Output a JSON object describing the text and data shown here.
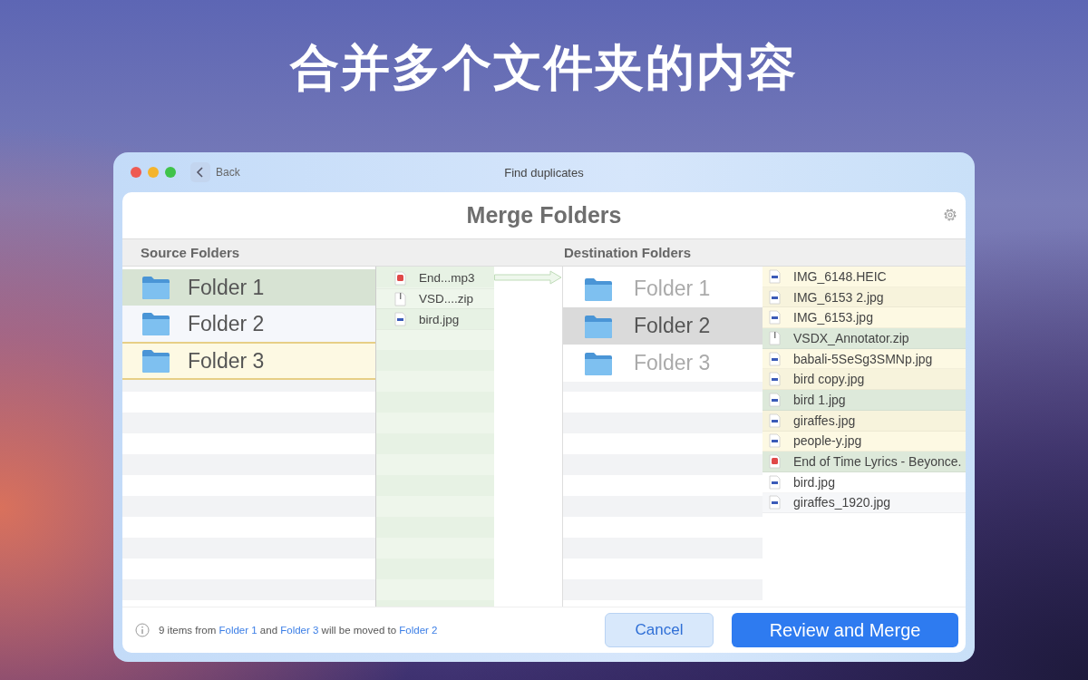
{
  "headline": "合并多个文件夹的内容",
  "window": {
    "title": "Find duplicates",
    "back": "Back"
  },
  "panel": {
    "title": "Merge Folders"
  },
  "source": {
    "heading": "Source Folders",
    "folders": [
      {
        "name": "Folder 1",
        "color": "#d7e3d3"
      },
      {
        "name": "Folder 2",
        "color": "#f5f7fb"
      },
      {
        "name": "Folder 3",
        "color": "#fdf9e3"
      }
    ],
    "files": [
      {
        "name": "End...mp3",
        "kind": "audio"
      },
      {
        "name": "VSD....zip",
        "kind": "archive"
      },
      {
        "name": "bird.jpg",
        "kind": "image"
      }
    ]
  },
  "destination": {
    "heading": "Destination Folders",
    "folders": [
      {
        "name": "Folder 1",
        "selected": false
      },
      {
        "name": "Folder 2",
        "selected": true
      },
      {
        "name": "Folder 3",
        "selected": false
      }
    ],
    "files": [
      {
        "name": "IMG_6148.HEIC",
        "kind": "image",
        "color": "#fdf9e3"
      },
      {
        "name": "IMG_6153 2.jpg",
        "kind": "image",
        "color": "#f7f3dc"
      },
      {
        "name": "IMG_6153.jpg",
        "kind": "image",
        "color": "#fdf9e3"
      },
      {
        "name": "VSDX_Annotator.zip",
        "kind": "archive",
        "color": "#dde9da"
      },
      {
        "name": "babali-5SeSg3SMNp.jpg",
        "kind": "image",
        "color": "#fdf9e3"
      },
      {
        "name": "bird copy.jpg",
        "kind": "image",
        "color": "#f7f3dc"
      },
      {
        "name": "bird 1.jpg",
        "kind": "image",
        "color": "#dde9da"
      },
      {
        "name": "giraffes.jpg",
        "kind": "image",
        "color": "#f7f3dc"
      },
      {
        "name": "people-y.jpg",
        "kind": "image",
        "color": "#fdf9e3"
      },
      {
        "name": "End of Time Lyrics - Beyonce.",
        "kind": "audio",
        "color": "#dde9da"
      },
      {
        "name": "bird.jpg",
        "kind": "image",
        "color": "#ffffff"
      },
      {
        "name": "giraffes_1920.jpg",
        "kind": "image",
        "color": "#f6f7f9"
      }
    ]
  },
  "footer": {
    "message": [
      {
        "text": "9 items from ",
        "link": false
      },
      {
        "text": "Folder 1",
        "link": true
      },
      {
        "text": " and ",
        "link": false
      },
      {
        "text": "Folder 3",
        "link": true
      },
      {
        "text": " will be moved to ",
        "link": false
      },
      {
        "text": "Folder 2",
        "link": true
      }
    ],
    "buttons": [
      {
        "label": "Cancel",
        "kind": "secondary"
      },
      {
        "label": "Review and Merge",
        "kind": "primary"
      }
    ]
  }
}
